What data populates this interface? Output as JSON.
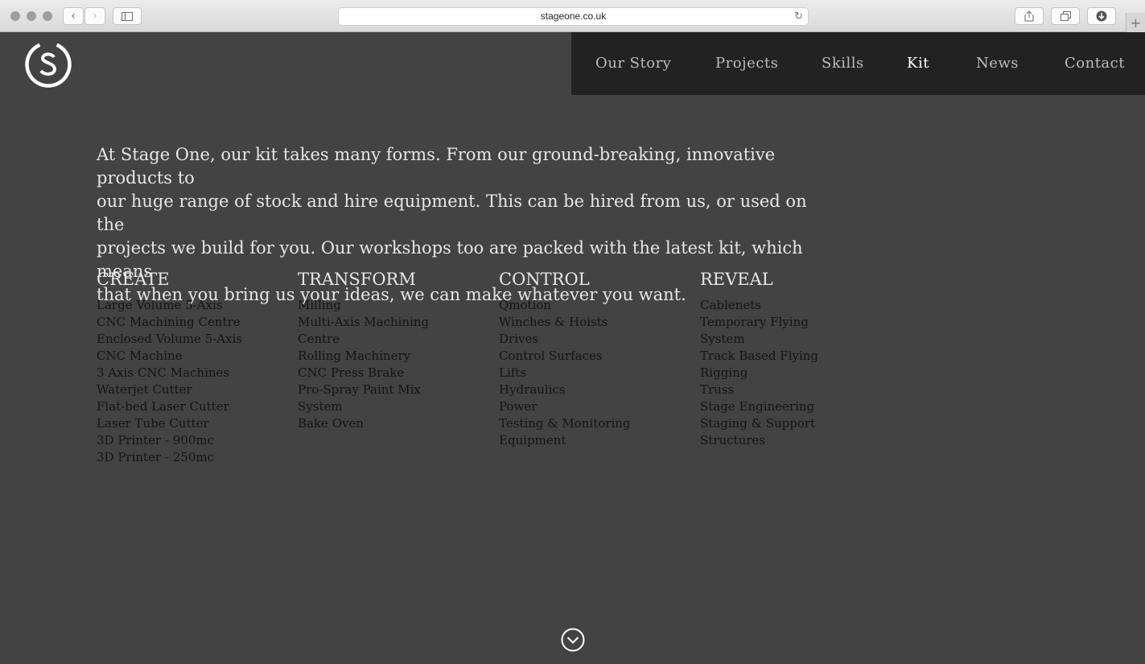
{
  "browser": {
    "url": "stageone.co.uk"
  },
  "nav": {
    "items": [
      "Our Story",
      "Projects",
      "Skills",
      "Kit",
      "News",
      "Contact"
    ],
    "active": "Kit"
  },
  "intro": {
    "lines": [
      "At Stage One, our kit takes many forms. From our ground-breaking, innovative products to",
      "our huge range of stock and hire equipment. This can be hired from us, or used on the",
      "projects we build for you. Our workshops too are packed with the latest kit, which means",
      "that when you bring us your ideas, we can make whatever you want."
    ]
  },
  "columns": [
    {
      "heading": "CREATE",
      "items": [
        "Large Volume 5-Axis",
        "CNC Machining Centre",
        "Enclosed Volume 5-Axis",
        "CNC Machine",
        "3 Axis CNC Machines",
        "Waterjet Cutter",
        "Flat-bed Laser Cutter",
        "Laser Tube Cutter",
        "3D Printer - 900mc",
        "3D Printer - 250mc"
      ]
    },
    {
      "heading": "TRANSFORM",
      "items": [
        "Milling",
        "Multi-Axis Machining",
        "Centre",
        "Rolling Machinery",
        "CNC Press Brake",
        "Pro-Spray Paint Mix",
        "System",
        "Bake Oven"
      ]
    },
    {
      "heading": "CONTROL",
      "items": [
        "Qmotion",
        "Winches & Hoists",
        "Drives",
        "Control Surfaces",
        "Lifts",
        "Hydraulics",
        "Power",
        "Testing & Monitoring",
        "Equipment"
      ]
    },
    {
      "heading": "REVEAL",
      "items": [
        "Cablenets",
        "Temporary Flying",
        "System",
        "Track Based Flying",
        "Rigging",
        "Truss",
        "Stage Engineering",
        "Staging & Support",
        "Structures"
      ]
    }
  ],
  "colors": {
    "page_bg": "#434343",
    "nav_bg": "#222222",
    "heading_text": "#e6e6e6",
    "list_text": "#141414"
  },
  "icons": {
    "logo": "stage-one-s-logo",
    "scroll": "chevron-down-circle-icon"
  }
}
